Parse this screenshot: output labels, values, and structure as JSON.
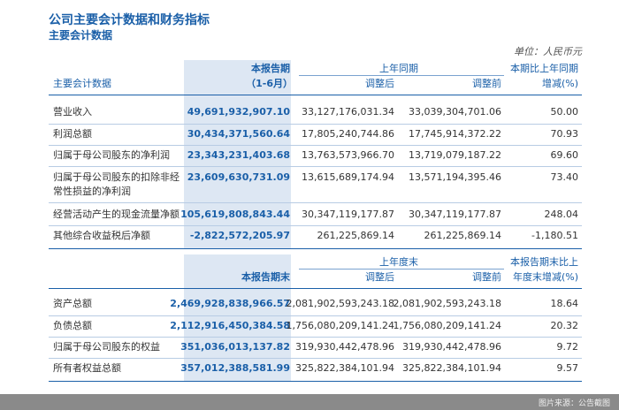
{
  "title": "公司主要会计数据和财务指标",
  "subtitle": "主要会计数据",
  "unit": "单位：人民币元",
  "table1": {
    "header": {
      "item": "主要会计数据",
      "current_line1": "本报告期",
      "current_line2": "（1-6月）",
      "prior_group": "上年同期",
      "adjusted": "调整后",
      "before_adjust": "调整前",
      "change_line1": "本期比上年同期",
      "change_line2": "增减(%)"
    },
    "rows": [
      {
        "label": "营业收入",
        "current": "49,691,932,907.10",
        "adjusted": "33,127,176,031.34",
        "before": "33,039,304,701.06",
        "change": "50.00"
      },
      {
        "label": "利润总额",
        "current": "30,434,371,560.64",
        "adjusted": "17,805,240,744.86",
        "before": "17,745,914,372.22",
        "change": "70.93"
      },
      {
        "label": "归属于母公司股东的净利润",
        "current": "23,343,231,403.68",
        "adjusted": "13,763,573,966.70",
        "before": "13,719,079,187.22",
        "change": "69.60"
      },
      {
        "label": "归属于母公司股东的扣除非经",
        "label2": "常性损益的净利润",
        "current": "23,609,630,731.09",
        "adjusted": "13,615,689,174.94",
        "before": "13,571,194,395.46",
        "change": "73.40"
      },
      {
        "label": "经营活动产生的现金流量净额",
        "current": "105,619,808,843.44",
        "adjusted": "30,347,119,177.87",
        "before": "30,347,119,177.87",
        "change": "248.04"
      },
      {
        "label": "其他综合收益税后净额",
        "current": "-2,822,572,205.97",
        "adjusted": "261,225,869.14",
        "before": "261,225,869.14",
        "change": "-1,180.51"
      }
    ]
  },
  "table2": {
    "header": {
      "current": "本报告期末",
      "prior_group": "上年度末",
      "adjusted": "调整后",
      "before_adjust": "调整前",
      "change_line1": "本报告期末比上",
      "change_line2": "年度末增减(%)"
    },
    "rows": [
      {
        "label": "资产总额",
        "current": "2,469,928,838,966.57",
        "adjusted": "2,081,902,593,243.18",
        "before": "2,081,902,593,243.18",
        "change": "18.64"
      },
      {
        "label": "负债总额",
        "current": "2,112,916,450,384.58",
        "adjusted": "1,756,080,209,141.24",
        "before": "1,756,080,209,141.24",
        "change": "20.32"
      },
      {
        "label": "归属于母公司股东的权益",
        "current": "351,036,013,137.82",
        "adjusted": "319,930,442,478.96",
        "before": "319,930,442,478.96",
        "change": "9.72"
      },
      {
        "label": "所有者权益总额",
        "current": "357,012,388,581.99",
        "adjusted": "325,822,384,101.94",
        "before": "325,822,384,101.94",
        "change": "9.57"
      }
    ]
  },
  "footer": "图片来源：公告截图",
  "colors": {
    "accent": "#1a5fa8",
    "highlight": "#dde7f3",
    "footer_bg": "#8a8a8a"
  }
}
